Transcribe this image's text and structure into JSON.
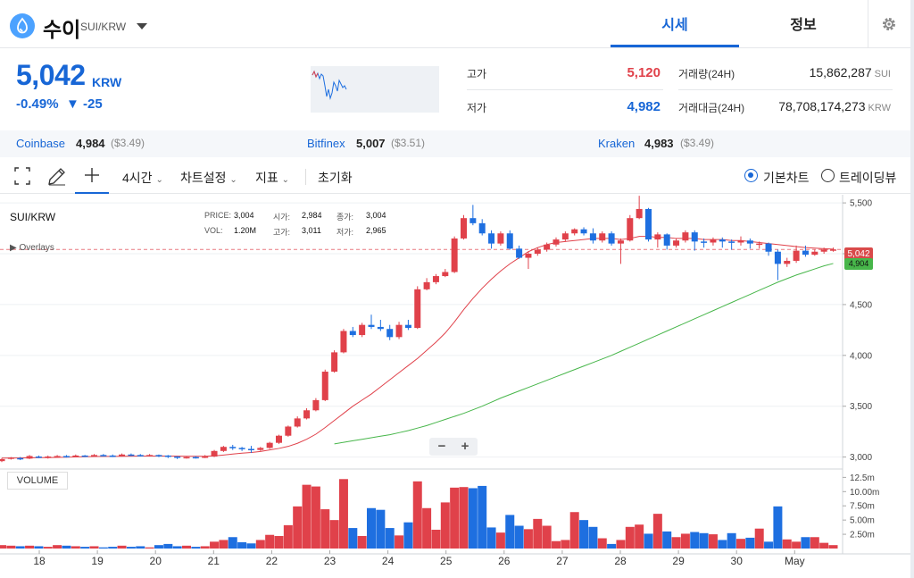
{
  "header": {
    "coin_name": "수이",
    "pair": "SUI/KRW",
    "tabs": [
      {
        "label": "시세"
      },
      {
        "label": "정보"
      }
    ]
  },
  "ticker": {
    "price": "5,042",
    "unit": "KRW",
    "change_rate": "-0.49%",
    "change_amount": "▼ -25",
    "high_label": "고가",
    "high_value": "5,120",
    "low_label": "저가",
    "low_value": "4,982",
    "volume_label": "거래량(24H)",
    "volume_value": "15,862,287",
    "volume_unit": "SUI",
    "amount_label": "거래대금(24H)",
    "amount_value": "78,708,174,273",
    "amount_unit": "KRW"
  },
  "exchanges": [
    {
      "name": "Coinbase",
      "price": "4,984",
      "usd": "($3.49)"
    },
    {
      "name": "Bitfinex",
      "price": "5,007",
      "usd": "($3.51)"
    },
    {
      "name": "Kraken",
      "price": "4,983",
      "usd": "($3.49)"
    }
  ],
  "toolbar": {
    "interval": "4시간",
    "chart_settings": "차트설정",
    "indicators": "지표",
    "reset": "초기화",
    "view_basic": "기본차트",
    "view_trading": "트레이딩뷰"
  },
  "legend": {
    "pair": "SUI/KRW",
    "overlays": "▶ Overlays",
    "price_label": "PRICE:",
    "price_value": "3,004",
    "open_label": "시가:",
    "open_value": "2,984",
    "close_label": "종가:",
    "close_value": "3,004",
    "vol_label": "VOL:",
    "vol_value": "1.20M",
    "high_label": "고가:",
    "high_value": "3,011",
    "low_label": "저가:",
    "low_value": "2,965",
    "volume_button": "VOLUME",
    "zoom_out": "−",
    "zoom_in": "+",
    "last_price_tag": "5,042",
    "ma_tag": "4,904"
  },
  "colors": {
    "up": "#e0414a",
    "down": "#1e6fe0",
    "accent": "#1766d6",
    "ma_short": "#e0414a",
    "ma_long": "#47b64a"
  },
  "chart_data": {
    "type": "candlestick",
    "y_ticks": [
      "5,500",
      "5,000",
      "4,500",
      "4,000",
      "3,500",
      "3,000"
    ],
    "y_tick_values": [
      5500,
      5000,
      4500,
      4000,
      3500,
      3000
    ],
    "ylim": [
      2900,
      5580
    ],
    "x_ticks": [
      "18",
      "19",
      "20",
      "21",
      "22",
      "23",
      "24",
      "25",
      "26",
      "27",
      "28",
      "29",
      "30",
      "May"
    ],
    "volume_ticks": [
      "12.5m",
      "10.00m",
      "7.50m",
      "5.00m",
      "2.50m"
    ],
    "volume_tick_values": [
      12.5,
      10.0,
      7.5,
      5.0,
      2.5
    ],
    "volume_max": 13.5,
    "candles": [
      [
        2960,
        2980,
        2950,
        2990
      ],
      [
        2985,
        2995,
        2975,
        3000
      ],
      [
        2990,
        2985,
        2970,
        3000
      ],
      [
        2985,
        3010,
        2980,
        3020
      ],
      [
        3005,
        3000,
        2990,
        3015
      ],
      [
        3000,
        3005,
        2985,
        3015
      ],
      [
        3005,
        3010,
        2995,
        3020
      ],
      [
        3010,
        3005,
        2995,
        3020
      ],
      [
        3005,
        3015,
        3000,
        3025
      ],
      [
        3015,
        3010,
        3000,
        3020
      ],
      [
        3010,
        3020,
        3005,
        3030
      ],
      [
        3020,
        3015,
        3005,
        3030
      ],
      [
        3015,
        3010,
        3000,
        3025
      ],
      [
        3010,
        3025,
        3005,
        3035
      ],
      [
        3025,
        3020,
        3010,
        3035
      ],
      [
        3020,
        3015,
        3005,
        3030
      ],
      [
        3015,
        3020,
        3005,
        3030
      ],
      [
        3020,
        3015,
        3000,
        3025
      ],
      [
        3015,
        3005,
        2990,
        3020
      ],
      [
        3005,
        2995,
        2980,
        3010
      ],
      [
        2995,
        3000,
        2985,
        3010
      ],
      [
        3000,
        2995,
        2985,
        3010
      ],
      [
        2995,
        3005,
        2990,
        3020
      ],
      [
        3005,
        3060,
        3000,
        3070
      ],
      [
        3060,
        3100,
        3050,
        3110
      ],
      [
        3100,
        3090,
        3070,
        3120
      ],
      [
        3090,
        3080,
        3060,
        3100
      ],
      [
        3080,
        3070,
        3040,
        3110
      ],
      [
        3070,
        3090,
        3060,
        3100
      ],
      [
        3090,
        3140,
        3080,
        3150
      ],
      [
        3140,
        3210,
        3130,
        3220
      ],
      [
        3210,
        3300,
        3200,
        3310
      ],
      [
        3300,
        3380,
        3290,
        3400
      ],
      [
        3380,
        3460,
        3370,
        3480
      ],
      [
        3460,
        3560,
        3450,
        3580
      ],
      [
        3560,
        3840,
        3550,
        3860
      ],
      [
        3840,
        4030,
        3830,
        4050
      ],
      [
        4030,
        4240,
        4020,
        4260
      ],
      [
        4240,
        4200,
        4180,
        4280
      ],
      [
        4200,
        4300,
        4180,
        4320
      ],
      [
        4300,
        4280,
        4260,
        4400
      ],
      [
        4280,
        4260,
        4240,
        4350
      ],
      [
        4260,
        4180,
        4150,
        4300
      ],
      [
        4180,
        4300,
        4160,
        4330
      ],
      [
        4300,
        4270,
        4250,
        4350
      ],
      [
        4270,
        4650,
        4260,
        4680
      ],
      [
        4650,
        4720,
        4640,
        4760
      ],
      [
        4720,
        4780,
        4700,
        4800
      ],
      [
        4780,
        4820,
        4770,
        4850
      ],
      [
        4820,
        5150,
        4810,
        5170
      ],
      [
        5150,
        5350,
        5140,
        5380
      ],
      [
        5350,
        5300,
        5280,
        5480
      ],
      [
        5300,
        5200,
        5180,
        5340
      ],
      [
        5200,
        5100,
        5050,
        5230
      ],
      [
        5100,
        5200,
        5080,
        5220
      ],
      [
        5200,
        5050,
        5040,
        5230
      ],
      [
        5050,
        4960,
        4950,
        5080
      ],
      [
        4960,
        5000,
        4850,
        5020
      ],
      [
        5000,
        5040,
        4980,
        5060
      ],
      [
        5040,
        5090,
        5020,
        5110
      ],
      [
        5090,
        5140,
        5070,
        5160
      ],
      [
        5140,
        5200,
        5120,
        5220
      ],
      [
        5200,
        5240,
        5180,
        5250
      ],
      [
        5240,
        5200,
        5180,
        5260
      ],
      [
        5200,
        5130,
        5100,
        5250
      ],
      [
        5130,
        5200,
        5110,
        5220
      ],
      [
        5200,
        5100,
        5080,
        5220
      ],
      [
        5100,
        5130,
        4900,
        5150
      ],
      [
        5130,
        5350,
        5120,
        5380
      ],
      [
        5350,
        5440,
        5340,
        5570
      ],
      [
        5440,
        5140,
        5120,
        5450
      ],
      [
        5140,
        5190,
        5060,
        5210
      ],
      [
        5190,
        5080,
        5040,
        5200
      ],
      [
        5080,
        5130,
        5060,
        5150
      ],
      [
        5130,
        5210,
        5110,
        5230
      ],
      [
        5210,
        5120,
        5030,
        5230
      ],
      [
        5120,
        5110,
        5060,
        5150
      ],
      [
        5110,
        5140,
        5080,
        5160
      ],
      [
        5140,
        5120,
        5060,
        5160
      ],
      [
        5120,
        5110,
        5040,
        5140
      ],
      [
        5110,
        5130,
        5080,
        5170
      ],
      [
        5130,
        5100,
        5050,
        5150
      ],
      [
        5100,
        5100,
        5050,
        5120
      ],
      [
        5100,
        5020,
        4980,
        5110
      ],
      [
        5020,
        4900,
        4740,
        5040
      ],
      [
        4900,
        4930,
        4870,
        4960
      ],
      [
        4930,
        5030,
        4910,
        5080
      ],
      [
        5030,
        4990,
        4970,
        5080
      ],
      [
        4990,
        5020,
        4980,
        5040
      ],
      [
        5020,
        5042,
        5000,
        5060
      ],
      [
        5042,
        5042,
        5020,
        5060
      ]
    ],
    "volumes": [
      0.6,
      0.5,
      0.4,
      0.5,
      0.4,
      0.3,
      0.6,
      0.5,
      0.4,
      0.3,
      0.4,
      0.2,
      0.3,
      0.5,
      0.3,
      0.4,
      0.2,
      0.6,
      0.8,
      0.4,
      0.5,
      0.3,
      0.4,
      1.2,
      1.5,
      2.0,
      1.1,
      0.9,
      1.5,
      2.4,
      2.2,
      4.1,
      7.4,
      11.2,
      10.9,
      6.9,
      5.0,
      12.2,
      3.6,
      2.2,
      7.1,
      6.8,
      3.6,
      2.3,
      4.6,
      11.8,
      7.1,
      3.3,
      8.1,
      10.7,
      10.8,
      10.6,
      11.0,
      3.7,
      2.8,
      5.9,
      4.0,
      3.4,
      5.2,
      4.0,
      1.3,
      1.5,
      6.4,
      5.0,
      3.8,
      1.8,
      0.8,
      1.5,
      3.8,
      4.2,
      2.6,
      6.1,
      3.0,
      2.0,
      2.6,
      2.9,
      2.7,
      2.5,
      1.5,
      2.7,
      1.7,
      1.9,
      3.5,
      1.2,
      7.4,
      1.6,
      1.2,
      2.0,
      2.0,
      1.0,
      0.6
    ],
    "ma_short": [
      2990,
      2990,
      2991,
      2992,
      2994,
      2995,
      2997,
      2999,
      3001,
      3003,
      3005,
      3006,
      3007,
      3008,
      3009,
      3010,
      3010,
      3010,
      3010,
      3009,
      3008,
      3008,
      3008,
      3012,
      3020,
      3030,
      3038,
      3045,
      3055,
      3070,
      3085,
      3105,
      3135,
      3175,
      3225,
      3290,
      3360,
      3430,
      3500,
      3560,
      3620,
      3690,
      3760,
      3830,
      3900,
      3970,
      4050,
      4130,
      4220,
      4330,
      4450,
      4560,
      4660,
      4750,
      4830,
      4900,
      4960,
      5020,
      5060,
      5090,
      5110,
      5120,
      5130,
      5140,
      5150,
      5150,
      5150,
      5140,
      5150,
      5170,
      5170,
      5160,
      5160,
      5150,
      5150,
      5150,
      5140,
      5140,
      5140,
      5130,
      5130,
      5120,
      5110,
      5100,
      5090,
      5080,
      5070,
      5060,
      5055,
      5050,
      5045
    ],
    "ma_long": [
      null,
      null,
      null,
      null,
      null,
      null,
      null,
      null,
      null,
      null,
      null,
      null,
      null,
      null,
      null,
      null,
      null,
      null,
      null,
      null,
      null,
      null,
      null,
      null,
      null,
      null,
      null,
      null,
      null,
      null,
      null,
      null,
      null,
      null,
      null,
      null,
      3130,
      3145,
      3160,
      3175,
      3190,
      3205,
      3220,
      3240,
      3260,
      3285,
      3310,
      3340,
      3370,
      3400,
      3430,
      3465,
      3500,
      3540,
      3580,
      3615,
      3650,
      3685,
      3720,
      3755,
      3790,
      3825,
      3860,
      3895,
      3930,
      3965,
      4000,
      4040,
      4080,
      4120,
      4160,
      4200,
      4240,
      4280,
      4320,
      4360,
      4400,
      4440,
      4480,
      4520,
      4560,
      4600,
      4640,
      4680,
      4720,
      4755,
      4790,
      4820,
      4850,
      4880,
      4904
    ]
  }
}
